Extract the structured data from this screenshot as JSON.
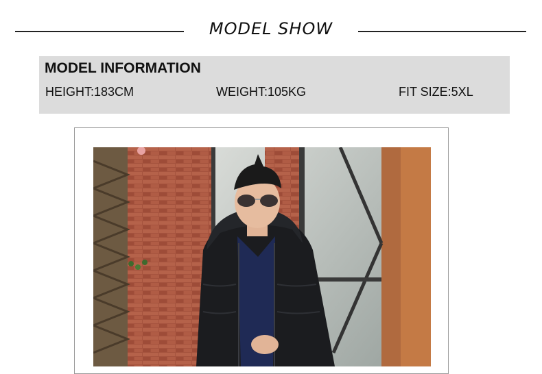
{
  "header": {
    "title": "MODEL SHOW"
  },
  "model_info": {
    "heading": "MODEL INFORMATION",
    "height": "HEIGHT:183CM",
    "weight": "WEIGHT:105KG",
    "fit_size": "FIT SIZE:5XL"
  },
  "photo": {
    "subject": "model-photo"
  }
}
